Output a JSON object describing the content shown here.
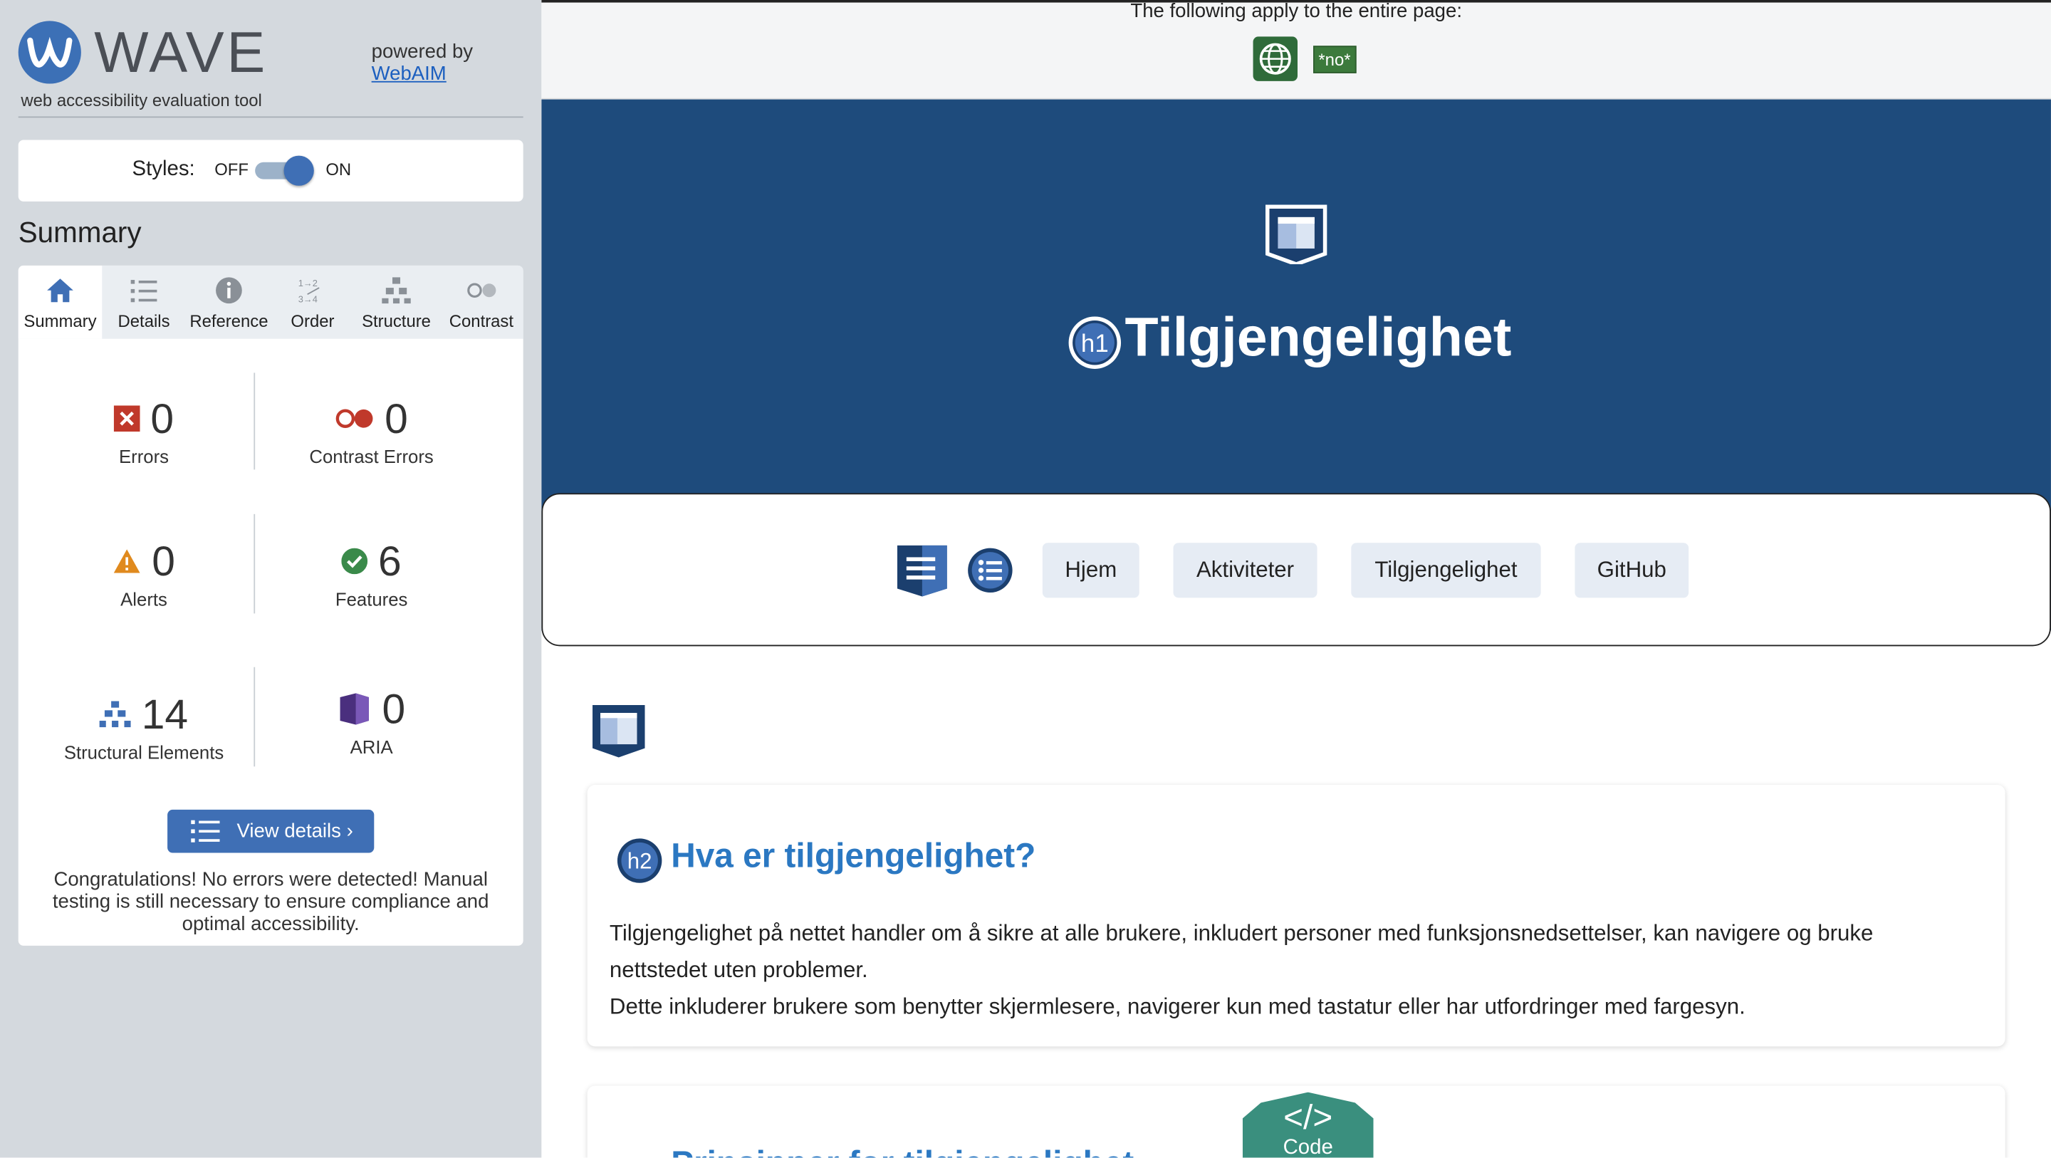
{
  "wave": {
    "logo_text": "WAVE",
    "subtitle": "web accessibility evaluation tool",
    "powered_by": "powered by",
    "webaim_link": "WebAIM",
    "styles_label": "Styles:",
    "styles_off": "OFF",
    "styles_on": "ON",
    "summary_title": "Summary",
    "tabs": [
      {
        "label": "Summary",
        "icon": "home-icon",
        "active": true
      },
      {
        "label": "Details",
        "icon": "list-icon"
      },
      {
        "label": "Reference",
        "icon": "info-icon"
      },
      {
        "label": "Order",
        "icon": "order-icon"
      },
      {
        "label": "Structure",
        "icon": "structure-icon"
      },
      {
        "label": "Contrast",
        "icon": "contrast-icon"
      }
    ],
    "stats": {
      "errors": {
        "count": "0",
        "label": "Errors"
      },
      "contrast_errors": {
        "count": "0",
        "label": "Contrast Errors"
      },
      "alerts": {
        "count": "0",
        "label": "Alerts"
      },
      "features": {
        "count": "6",
        "label": "Features"
      },
      "structural": {
        "count": "14",
        "label": "Structural Elements"
      },
      "aria": {
        "count": "0",
        "label": "ARIA"
      }
    },
    "view_details": "View details ›",
    "congrats": "Congratulations! No errors were detected! Manual testing is still necessary to ensure compliance and optimal accessibility."
  },
  "page": {
    "apply_text": "The following apply to the entire page:",
    "lang_tag": "*no*",
    "h1_badge": "h1",
    "title": "Tilgjengelighet",
    "nav": [
      "Hjem",
      "Aktiviteter",
      "Tilgjengelighet",
      "GitHub"
    ],
    "h2_badge": "h2",
    "card_title": "Hva er tilgjengelighet?",
    "card_p1": "Tilgjengelighet på nettet handler om å sikre at alle brukere, inkludert personer med funksjonsnedsettelser, kan navigere og bruke nettstedet uten problemer.",
    "card_p2": "Dette inkluderer brukere som benytter skjermlesere, navigerer kun med tastatur eller har utfordringer med fargesyn.",
    "card2_title": "Prinsipper for tilgjengelighet",
    "code_label": "Code"
  },
  "colors": {
    "wave_blue": "#3f6fb5",
    "hero_blue": "#1e4b7c",
    "link_blue": "#2b78c2",
    "sidebar_bg": "#d4d9de"
  }
}
